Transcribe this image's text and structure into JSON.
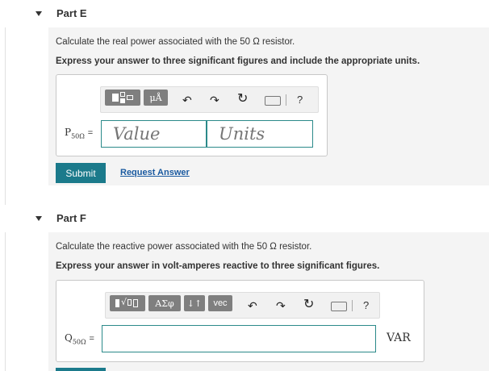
{
  "partE": {
    "title": "Part E",
    "question": "Calculate the real power associated with the 50 Ω resistor.",
    "instruction": "Express your answer to three significant figures and include the appropriate units.",
    "toolbar": {
      "micro_label": "μÅ",
      "help": "?"
    },
    "var_main": "P",
    "var_sub": "50Ω",
    "equals": "=",
    "value_placeholder": "Value",
    "units_placeholder": "Units",
    "submit_label": "Submit",
    "request_label": "Request Answer"
  },
  "partF": {
    "title": "Part F",
    "question": "Calculate the reactive power associated with the 50 Ω resistor.",
    "instruction": "Express your answer in volt-amperes reactive to three significant figures.",
    "toolbar": {
      "greek_label": "ΑΣφ",
      "arrows_label": "↓↑",
      "vec_label": "vec",
      "help": "?"
    },
    "var_main": "Q",
    "var_sub": "50Ω",
    "equals": "=",
    "answer_value": "",
    "units": "VAR"
  },
  "colors": {
    "accent": "#1b7a8b",
    "input_border": "#2b8a8a",
    "link": "#1a5aa0"
  }
}
